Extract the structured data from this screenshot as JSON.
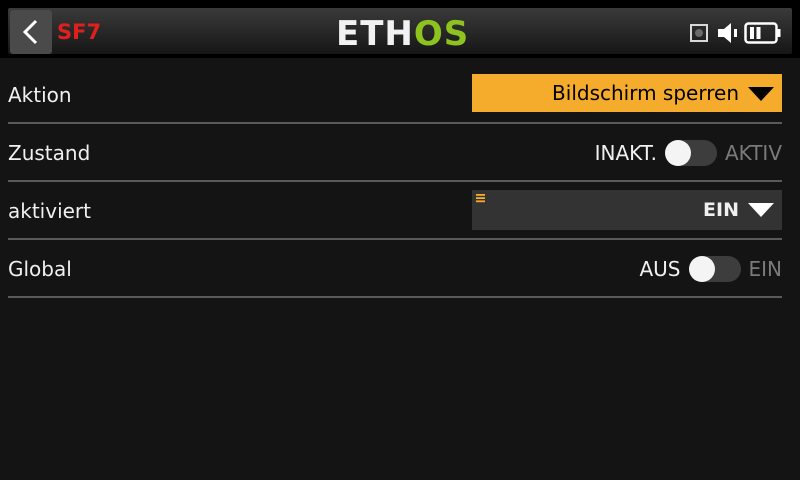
{
  "header": {
    "page_code": "SF7",
    "logo_left": "ETH",
    "logo_right": "OS",
    "icons": [
      "back-chevron-icon",
      "status-square-icon",
      "speaker-icon",
      "battery-icon"
    ]
  },
  "rows": [
    {
      "label": "Aktion",
      "value": "Bildschirm sperren"
    },
    {
      "label": "Zustand",
      "off_label": "INAKT.",
      "on_label": "AKTIV",
      "enabled": false
    },
    {
      "label": "aktiviert",
      "value": "EIN"
    },
    {
      "label": "Global",
      "off_label": "AUS",
      "on_label": "EIN",
      "enabled": false
    }
  ],
  "colors": {
    "accent_orange": "#f5ab2b",
    "title_red": "#e0201c",
    "logo_green": "#8dc21f",
    "background": "#141414"
  }
}
